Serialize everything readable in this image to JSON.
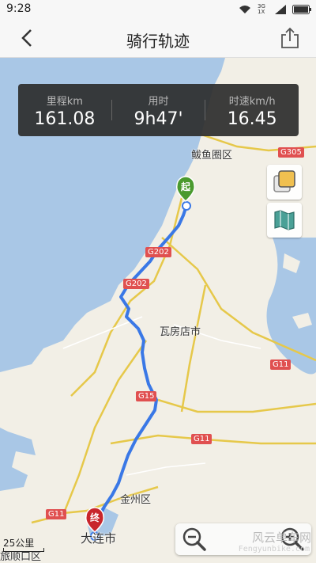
{
  "status": {
    "time": "9:28",
    "sim_text": "3G 1X"
  },
  "header": {
    "title": "骑行轨迹"
  },
  "stats": [
    {
      "label": "里程km",
      "value": "161.08"
    },
    {
      "label": "用时",
      "value": "9h47'"
    },
    {
      "label": "时速km/h",
      "value": "16.45"
    }
  ],
  "markers": {
    "start": "起",
    "end": "终"
  },
  "places": {
    "bayuquan": "鲅鱼圈区",
    "wafangdian": "瓦房店市",
    "jinzhou": "金州区",
    "dalian": "大连市",
    "lushunkou": "旅顺口区"
  },
  "roads": [
    "G305",
    "G202",
    "G202",
    "G11",
    "G15",
    "G11",
    "G11"
  ],
  "scale": {
    "label": "25公里"
  },
  "watermark": {
    "text": "风云单车网",
    "url": "Fengyunbike.com"
  },
  "colors": {
    "route": "#3a78e6",
    "start_marker": "#4a9a2e",
    "end_marker": "#c8262c",
    "sea": "#a9c7e6",
    "land": "#f2efe6",
    "panel": "#2d2d2d"
  }
}
